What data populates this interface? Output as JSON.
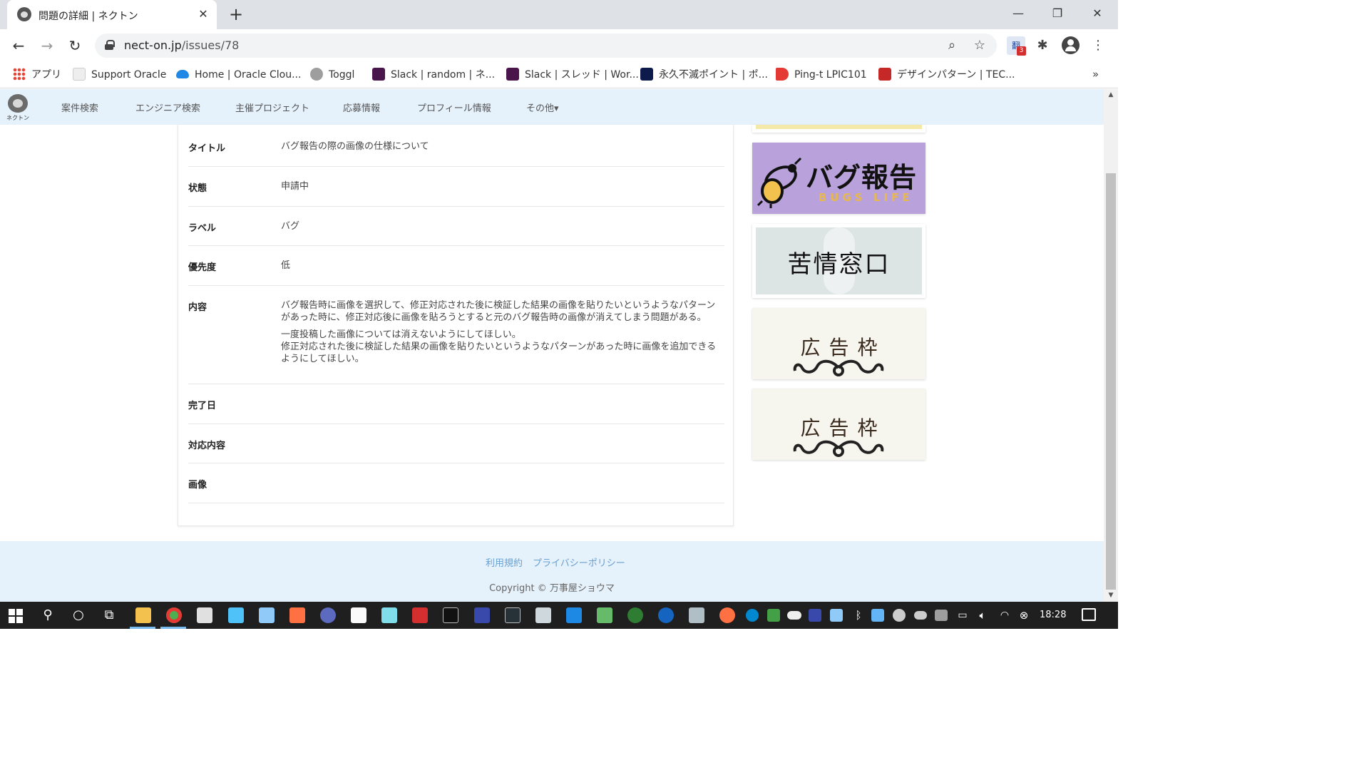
{
  "browser": {
    "tab_title": "問題の詳細 | ネクトン",
    "tab_close": "✕",
    "new_tab": "+",
    "url_domain": "nect-on.jp",
    "url_path": "/issues/78",
    "extension_badge": "3",
    "bookmarks": [
      {
        "label": "アプリ",
        "icon": "apps-grid-icon"
      },
      {
        "label": "Support Oracle",
        "icon": "oracle-support-icon",
        "color": "#e8e8e8"
      },
      {
        "label": "Home | Oracle Clou...",
        "icon": "cloud-icon",
        "color": "#1e88e5"
      },
      {
        "label": "Toggl",
        "icon": "toggl-icon",
        "color": "#9e9e9e"
      },
      {
        "label": "Slack | random | ネ...",
        "icon": "slack-icon",
        "color": "#4a154b"
      },
      {
        "label": "Slack | スレッド | Wor...",
        "icon": "slack-icon",
        "color": "#4a154b"
      },
      {
        "label": "永久不滅ポイント | ポ...",
        "icon": "chart-icon",
        "color": "#0d1b4c"
      },
      {
        "label": "Ping-t LPIC101",
        "icon": "ping-t-icon",
        "color": "#e53935"
      },
      {
        "label": "デザインパターン | TEC...",
        "icon": "tech-icon",
        "color": "#c62828"
      }
    ],
    "bookmarks_more": "»"
  },
  "site": {
    "logo_text": "ネクトン",
    "nav": [
      "案件検索",
      "エンジニア検索",
      "主催プロジェクト",
      "応募情報",
      "プロフィール情報",
      "その他▾"
    ]
  },
  "issue": {
    "rows": [
      {
        "label": "タイトル",
        "value": [
          "バグ報告の際の画像の仕様について"
        ]
      },
      {
        "label": "状態",
        "value": [
          "申請中"
        ]
      },
      {
        "label": "ラベル",
        "value": [
          "バグ"
        ]
      },
      {
        "label": "優先度",
        "value": [
          "低"
        ]
      },
      {
        "label": "内容",
        "value": [
          "バグ報告時に画像を選択して、修正対応された後に検証した結果の画像を貼りたいというようなパターンがあった時に、修正対応後に画像を貼ろうとすると元のバグ報告時の画像が消えてしまう問題がある。",
          "一度投稿した画像については消えないようにしてほしい。\n修正対応された後に検証した結果の画像を貼りたいというようなパターンがあった時に画像を追加できるようにしてほしい。"
        ]
      },
      {
        "label": "完了日",
        "value": []
      },
      {
        "label": "対応内容",
        "value": []
      },
      {
        "label": "画像",
        "value": []
      }
    ]
  },
  "banners": {
    "bug_title": "バグ報告",
    "bug_sub": "BUGS LIFE",
    "complaint": "苦情窓口",
    "ad1": "広告枠",
    "ad2": "広告枠"
  },
  "footer": {
    "links": [
      "利用規約",
      "プライバシーポリシー"
    ],
    "copyright": "Copyright © 万事屋ショウマ"
  },
  "taskbar": {
    "time": "18:28"
  },
  "colors": {
    "nav_bg": "#e5f1fb",
    "footer_link": "#6aa0d0",
    "bug_banner": "#b9a2dc"
  }
}
